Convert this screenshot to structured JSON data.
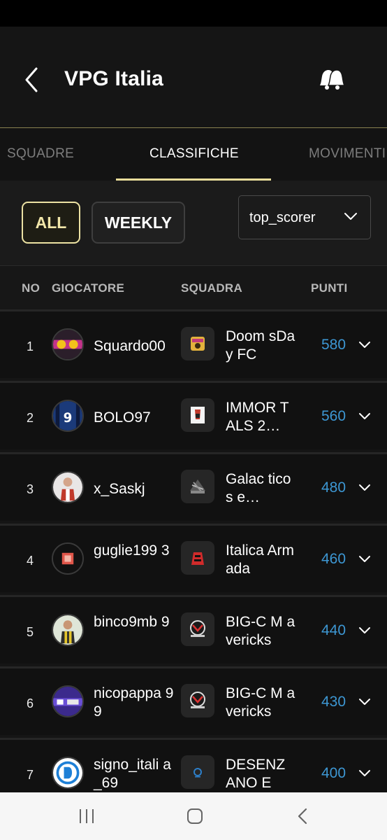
{
  "header": {
    "title": "VPG Italia",
    "back_icon": "chevron-left-icon",
    "bell_icon": "bells-icon"
  },
  "tabs": [
    {
      "label": "SQUADRE",
      "active": false
    },
    {
      "label": "CLASSIFICHE",
      "active": true
    },
    {
      "label": "MOVIMENTI",
      "active": false
    }
  ],
  "filters": {
    "all_label": "ALL",
    "weekly_label": "WEEKLY",
    "selected": "ALL",
    "select_value": "top_scorer"
  },
  "table": {
    "columns": [
      "NO",
      "GIOCATORE",
      "SQUADRA",
      "PUNTI"
    ],
    "rows": [
      {
        "rank": "1",
        "player": "Squardo00",
        "team": "Doom sDay FC",
        "points": "580"
      },
      {
        "rank": "2",
        "player": "BOLO97",
        "team": "IMMOR TALS 2…",
        "points": "560"
      },
      {
        "rank": "3",
        "player": "x_Saskj",
        "team": "Galac ticos e…",
        "points": "480"
      },
      {
        "rank": "4",
        "player": "guglie199 3",
        "team": "Italica Armada",
        "points": "460"
      },
      {
        "rank": "5",
        "player": "binco9mb 9",
        "team": "BIG-C M avericks",
        "points": "440"
      },
      {
        "rank": "6",
        "player": "nicopappa 99",
        "team": "BIG-C M avericks",
        "points": "430"
      },
      {
        "rank": "7",
        "player": "signo_itali a_69",
        "team": "DESENZ ANO ES…",
        "points": "400"
      }
    ]
  },
  "colors": {
    "accent": "#ece2a3",
    "points": "#3d97d3",
    "background": "#151515"
  },
  "nav": {
    "recent_icon": "recent-apps-icon",
    "home_icon": "home-icon",
    "back_icon": "back-icon"
  }
}
